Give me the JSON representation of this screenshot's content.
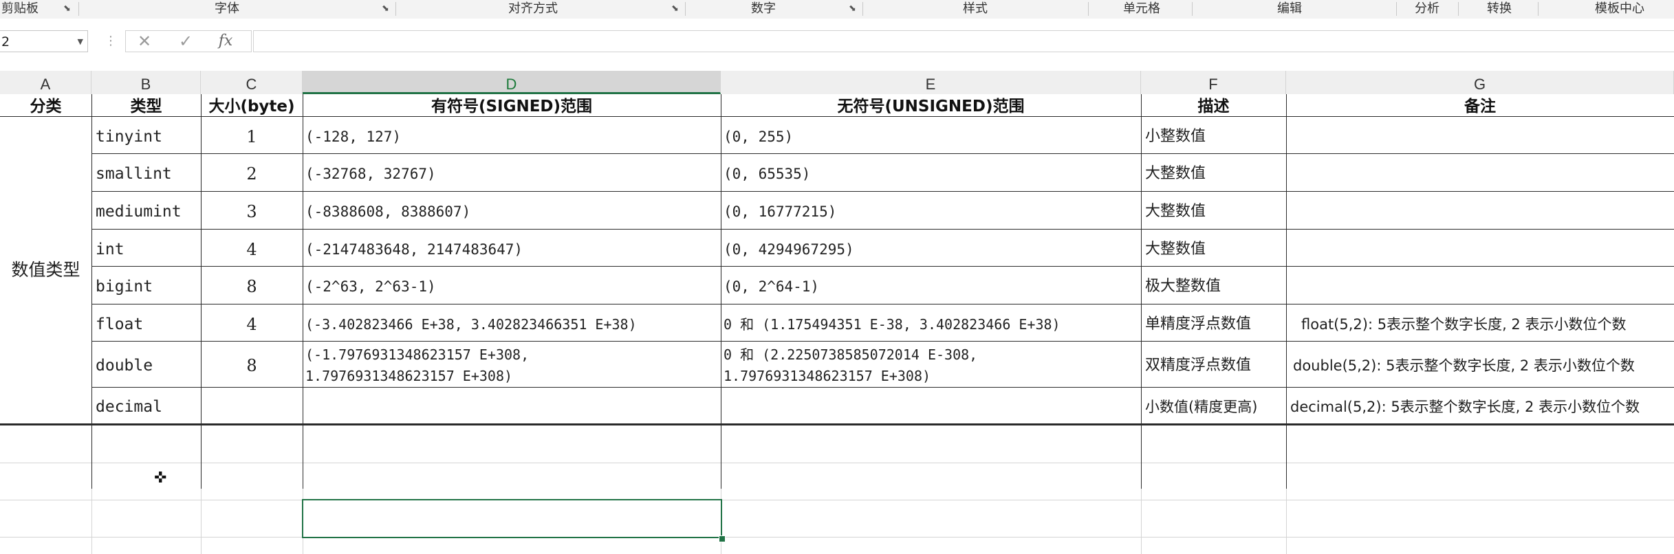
{
  "ribbon": {
    "groups": [
      "剪贴板",
      "字体",
      "对齐方式",
      "数字",
      "样式",
      "单元格",
      "编辑",
      "分析",
      "转换",
      "模板中心"
    ]
  },
  "formula_bar": {
    "name_box": "2",
    "cancel_icon": "✕",
    "enter_icon": "✓",
    "function_label": "fx",
    "content": ""
  },
  "columns": [
    "A",
    "B",
    "C",
    "D",
    "E",
    "F",
    "G"
  ],
  "active_column": "D",
  "table": {
    "headers": [
      "分类",
      "类型",
      "大小(byte)",
      "有符号(SIGNED)范围",
      "无符号(UNSIGNED)范围",
      "描述",
      "备注"
    ],
    "category": "数值类型",
    "rows": [
      {
        "type": "tinyint",
        "size": "1",
        "signed": "(-128, 127)",
        "unsigned": "(0, 255)",
        "desc": "小整数值",
        "note": ""
      },
      {
        "type": "smallint",
        "size": "2",
        "signed": "(-32768, 32767)",
        "unsigned": "(0, 65535)",
        "desc": "大整数值",
        "note": ""
      },
      {
        "type": "mediumint",
        "size": "3",
        "signed": "(-8388608, 8388607)",
        "unsigned": "(0, 16777215)",
        "desc": "大整数值",
        "note": ""
      },
      {
        "type": "int",
        "size": "4",
        "signed": "(-2147483648, 2147483647)",
        "unsigned": "(0, 4294967295)",
        "desc": "大整数值",
        "note": ""
      },
      {
        "type": "bigint",
        "size": "8",
        "signed": "(-2^63, 2^63-1)",
        "unsigned": "(0, 2^64-1)",
        "desc": "极大整数值",
        "note": ""
      },
      {
        "type": "float",
        "size": "4",
        "signed": "(-3.402823466 E+38, 3.402823466351 E+38)",
        "unsigned": "0 和 (1.175494351 E-38, 3.402823466 E+38)",
        "desc": "单精度浮点数值",
        "note": "float(5,2):  5表示整个数字长度, 2 表示小数位个数"
      },
      {
        "type": "double",
        "size": "8",
        "signed": "(-1.7976931348623157 E+308,\n1.7976931348623157 E+308)",
        "unsigned": "0 和 (2.2250738585072014 E-308,\n1.7976931348623157 E+308)",
        "desc": "双精度浮点数值",
        "note": "double(5,2):  5表示整个数字长度, 2 表示小数位个数"
      },
      {
        "type": "decimal",
        "size": "",
        "signed": "",
        "unsigned": "",
        "desc": "小数值(精度更高)",
        "note": "decimal(5,2):  5表示整个数字长度, 2 表示小数位个数"
      }
    ]
  }
}
